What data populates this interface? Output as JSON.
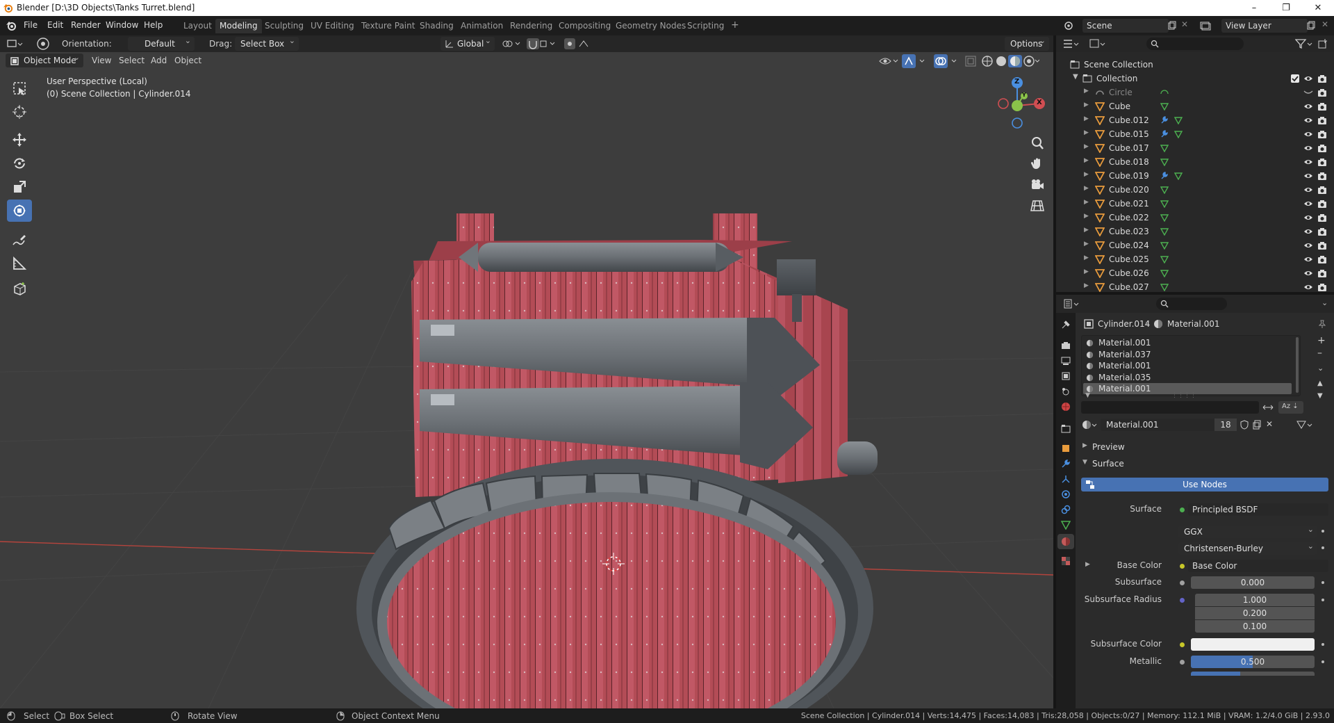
{
  "window": {
    "title": "Blender [D:\\3D Objects\\Tanks Turret.blend]",
    "minimize": "–",
    "maximize": "❐",
    "close": "✕"
  },
  "menu": {
    "file": "File",
    "edit": "Edit",
    "render": "Render",
    "window": "Window",
    "help": "Help"
  },
  "workspaces": [
    "Layout",
    "Modeling",
    "Sculpting",
    "UV Editing",
    "Texture Paint",
    "Shading",
    "Animation",
    "Rendering",
    "Compositing",
    "Geometry Nodes",
    "Scripting"
  ],
  "active_workspace": "Modeling",
  "add_workspace": "+",
  "scene": {
    "name": "Scene",
    "view_layer": "View Layer"
  },
  "header": {
    "orientation_label": "Orientation:",
    "orientation_value": "Default",
    "drag_label": "Drag:",
    "drag_value": "Select Box",
    "transform_orientation": "Global",
    "options": "Options"
  },
  "viewport_header": {
    "mode": "Object Mode",
    "view": "View",
    "select": "Select",
    "add": "Add",
    "object": "Object"
  },
  "viewport": {
    "perspective": "User Perspective (Local)",
    "context": "(0) Scene Collection | Cylinder.014"
  },
  "gizmo": {
    "z": "Z",
    "y": "Y",
    "x": "X"
  },
  "outliner": {
    "scene_collection": "Scene Collection",
    "collection": "Collection",
    "items": [
      "Circle",
      "Cube",
      "Cube.012",
      "Cube.015",
      "Cube.017",
      "Cube.018",
      "Cube.019",
      "Cube.020",
      "Cube.021",
      "Cube.022",
      "Cube.023",
      "Cube.024",
      "Cube.025",
      "Cube.026",
      "Cube.027"
    ]
  },
  "properties": {
    "object_name": "Cylinder.014",
    "material_breadcrumb": "Material.001",
    "slots": [
      "Material.001",
      "Material.037",
      "Material.001",
      "Material.035",
      "Material.001"
    ],
    "active_slot": 4,
    "material_name": "Material.001",
    "user_count": "18",
    "preview": "Preview",
    "surface_panel": "Surface",
    "use_nodes": "Use Nodes",
    "surface_label": "Surface",
    "surface_value": "Principled BSDF",
    "distribution": "GGX",
    "subsurface_method": "Christensen-Burley",
    "base_color_label": "Base Color",
    "base_color_value": "Base Color",
    "subsurface_label": "Subsurface",
    "subsurface_value": "0.000",
    "subsurface_radius_label": "Subsurface Radius",
    "subsurface_radius": [
      "1.000",
      "0.200",
      "0.100"
    ],
    "subsurface_color_label": "Subsurface Color",
    "metallic_label": "Metallic",
    "metallic_value": "0.500",
    "metallic_fraction": 0.5
  },
  "status": {
    "select": "Select",
    "box_select": "Box Select",
    "rotate_view": "Rotate View",
    "context_menu": "Object Context Menu",
    "stats": "Scene Collection | Cylinder.014 | Verts:14,475 | Faces:14,083 | Tris:28,058 | Objects:0/27 | Memory: 112.1 MiB | VRAM: 1.2/4.0 GiB | 2.93.0"
  },
  "colors": {
    "accent": "#4772b3",
    "red_wood": "#b5505a",
    "metal": "#6f7479",
    "axis_x": "#d14e52",
    "axis_y": "#8bc34a",
    "axis_z": "#4a8fe0"
  }
}
